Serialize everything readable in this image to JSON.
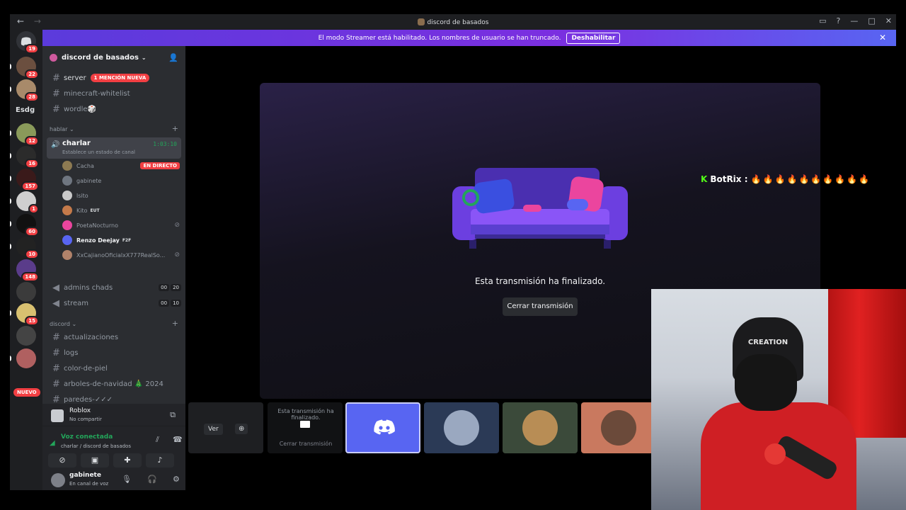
{
  "window": {
    "title": "discord de basados",
    "controls": [
      "▭",
      "?",
      "—",
      "□",
      "✕"
    ]
  },
  "banner": {
    "text": "El modo Streamer está habilitado. Los nombres de usuario se han truncado.",
    "button": "Deshabilitar"
  },
  "rail": {
    "items": [
      {
        "badge": "19"
      },
      {
        "badge": "22"
      },
      {
        "badge": "28"
      },
      {
        "text": "Esdg"
      },
      {
        "badge": "12"
      },
      {
        "badge": "16"
      },
      {
        "badge": "157"
      },
      {
        "badge": "1"
      },
      {
        "badge": "60"
      },
      {
        "badge": "10"
      },
      {
        "badge": "148"
      },
      {
        "badge": ""
      },
      {
        "badge": "15"
      },
      {
        "badge": ""
      },
      {
        "badge": ""
      }
    ],
    "nuevo": "NUEVO"
  },
  "server": {
    "name": "discord de basados"
  },
  "channels": {
    "server": {
      "name": "server",
      "mention": "1 MENCIÓN NUEVA"
    },
    "minecraft": "minecraft-whitelist",
    "wordle": "wordle🎲",
    "cat_hablar": "hablar",
    "charlar": {
      "name": "charlar",
      "status": "Establece un estado de canal",
      "timer": "1:03:10"
    },
    "voice_users": [
      {
        "name": "Cacha",
        "live": "EN DIRECTO"
      },
      {
        "name": "gabinete"
      },
      {
        "name": "lsito"
      },
      {
        "name": "Kito",
        "tag": "EUT"
      },
      {
        "name": "PoetaNocturno"
      },
      {
        "name": "Renzo Deejay",
        "tag": "F2F"
      },
      {
        "name": "XxCajianoOficialxX777RealSo..."
      }
    ],
    "admins": {
      "name": "admins chads",
      "c1": "00",
      "c2": "20"
    },
    "stream": {
      "name": "stream",
      "c1": "00",
      "c2": "10"
    },
    "cat_discord": "discord",
    "actualizaciones": "actualizaciones",
    "logs": "logs",
    "color": "color-de-piel",
    "arboles": "arboles-de-navidad 🎄 2024",
    "paredes": "paredes-✓✓✓"
  },
  "activity": {
    "game": "Roblox",
    "sub": "No compartir"
  },
  "voice": {
    "status": "Voz conectada",
    "where": "charlar / discord de basados"
  },
  "user": {
    "name": "gabinete",
    "status": "En canal de voz"
  },
  "stage": {
    "ended": "Esta transmisión ha finalizado.",
    "close": "Cerrar transmisión"
  },
  "tiles": {
    "ver": "Ver",
    "ended": "Esta transmisión ha finalizado.",
    "close": "Cerrar transmisión"
  },
  "overlay": {
    "botrix": "BotRix :",
    "flames": "🔥🔥🔥🔥🔥🔥🔥🔥🔥🔥",
    "chair_brand": "CREATION"
  },
  "colors": {
    "blurple": "#5865f2",
    "green": "#23a55a",
    "red": "#f23f43"
  }
}
